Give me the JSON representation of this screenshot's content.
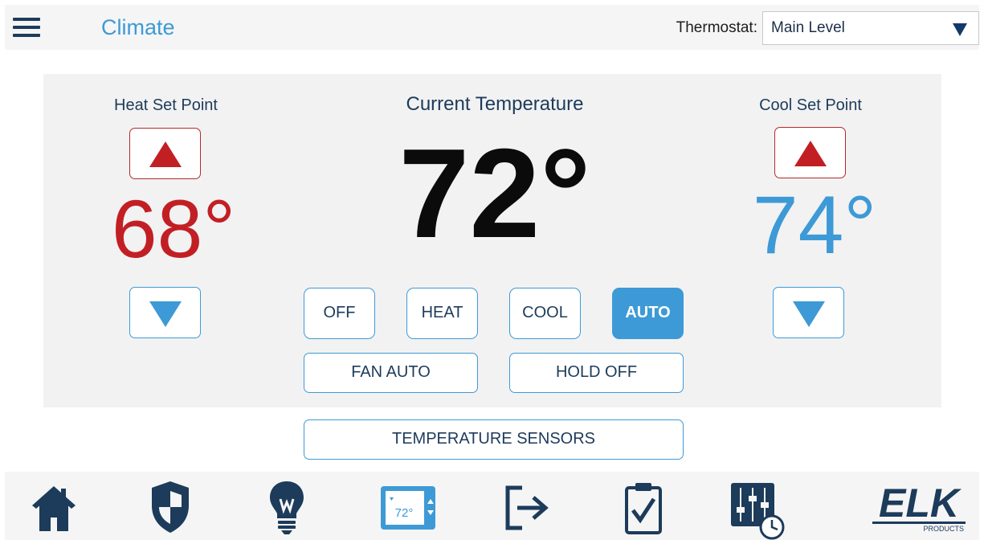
{
  "header": {
    "title": "Climate",
    "thermostat_label": "Thermostat:",
    "thermostat_selected": "Main Level"
  },
  "panel": {
    "heat_label": "Heat Set Point",
    "heat_value": "68°",
    "current_label": "Current Temperature",
    "current_value": "72°",
    "cool_label": "Cool Set Point",
    "cool_value": "74°",
    "modes": [
      "OFF",
      "HEAT",
      "COOL",
      "AUTO"
    ],
    "active_mode": "AUTO",
    "fan_label": "FAN AUTO",
    "hold_label": "HOLD OFF"
  },
  "sensors_button": "TEMPERATURE SENSORS",
  "nav": {
    "items": [
      "home-icon",
      "security-shield-icon",
      "lightbulb-icon",
      "thermostat-icon",
      "exit-icon",
      "clipboard-check-icon",
      "schedule-sliders-icon"
    ],
    "thermostat_icon_text": "72°",
    "logo_text": "ELK",
    "logo_sub": "PRODUCTS"
  },
  "colors": {
    "accent": "#3d9ad6",
    "heat": "#c21f24",
    "navy": "#1d3b5a"
  }
}
